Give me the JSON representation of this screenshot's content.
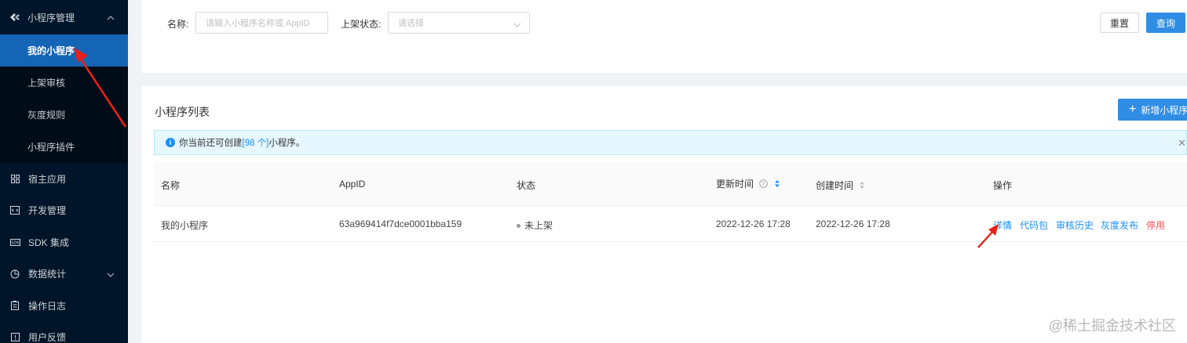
{
  "sidebar": {
    "group": {
      "label": "小程序管理",
      "icon": "mini-program-icon"
    },
    "sub_items": [
      {
        "label": "我的小程序",
        "active": true
      },
      {
        "label": "上架审核"
      },
      {
        "label": "灰度规则"
      },
      {
        "label": "小程序插件"
      }
    ],
    "items": [
      {
        "label": "宿主应用",
        "icon": "grid-icon"
      },
      {
        "label": "开发管理",
        "icon": "code-icon"
      },
      {
        "label": "SDK 集成",
        "icon": "sdk-icon"
      },
      {
        "label": "数据统计",
        "icon": "pie-chart-icon"
      },
      {
        "label": "操作日志",
        "icon": "log-icon"
      },
      {
        "label": "用户反馈",
        "icon": "feedback-icon"
      }
    ]
  },
  "search": {
    "name_label": "名称:",
    "name_placeholder": "请输入小程序名称或 AppID",
    "status_label": "上架状态:",
    "status_placeholder": "请选择",
    "reset_label": "重置",
    "query_label": "查询"
  },
  "list": {
    "title": "小程序列表",
    "add_label": "新增小程序",
    "alert_prefix": "你当前还可创建",
    "alert_highlight": "[98 个]",
    "alert_suffix": "小程序。",
    "columns": [
      "名称",
      "AppID",
      "状态",
      "更新时间",
      "创建时间",
      "操作"
    ],
    "rows": [
      {
        "name": "我的小程序",
        "appid": "63a969414f7dce0001bba159",
        "status": "未上架",
        "updated": "2022-12-26 17:28",
        "created": "2022-12-26 17:28"
      }
    ],
    "actions": [
      "详情",
      "代码包",
      "审核历史",
      "灰度发布",
      "停用"
    ]
  },
  "watermark": "@稀土掘金技术社区",
  "colors": {
    "primary": "#2f8de4",
    "sidebar_bg": "#001529",
    "active_bg": "#1565b6",
    "danger": "#ff4d4f",
    "annotation": "#e8201a"
  }
}
